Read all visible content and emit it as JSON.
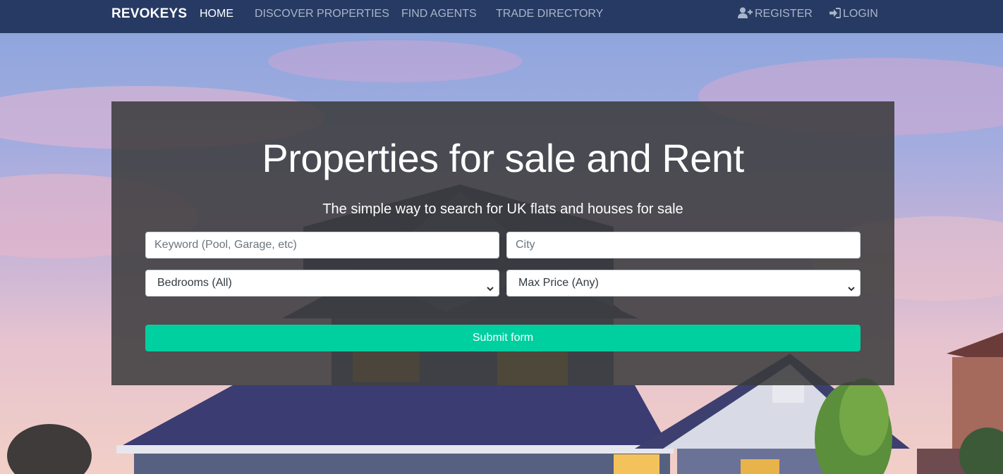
{
  "nav": {
    "brand": "REVOKEYS",
    "links": [
      {
        "label": "HOME",
        "active": true
      },
      {
        "label": "DISCOVER PROPERTIES",
        "active": false
      },
      {
        "label": "FIND AGENTS",
        "active": false
      },
      {
        "label": "TRADE DIRECTORY",
        "active": false
      }
    ],
    "register": {
      "label": "REGISTER",
      "icon": "user-plus-icon"
    },
    "login": {
      "label": "LOGIN",
      "icon": "sign-in-icon"
    }
  },
  "hero": {
    "title": "Properties for sale and Rent",
    "subtitle": "The simple way to search for UK flats and houses for sale"
  },
  "form": {
    "keyword_placeholder": "Keyword (Pool, Garage, etc)",
    "city_placeholder": "City",
    "bedrooms_selected": "Bedrooms (All)",
    "max_price_selected": "Max Price (Any)",
    "submit_label": "Submit form"
  },
  "colors": {
    "navbar": "#273a63",
    "panel": "#3a3a3a",
    "submit": "#00cfa0"
  }
}
